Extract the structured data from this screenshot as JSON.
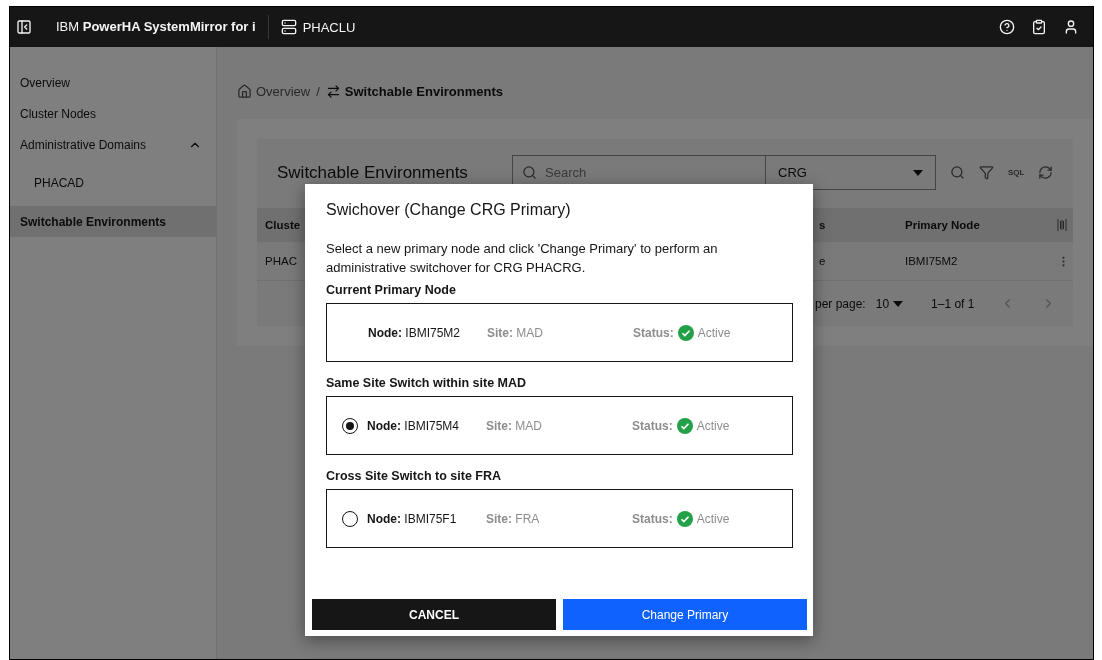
{
  "header": {
    "app_name": "IBM **PowerHA SystemMirror for i**",
    "cluster": "PHACLU"
  },
  "sidebar": {
    "items": [
      {
        "label": "Overview",
        "selected": false
      },
      {
        "label": "Cluster Nodes",
        "selected": false
      },
      {
        "label": "Administrative Domains",
        "selected": false,
        "expanded": true,
        "children": [
          {
            "label": "PHACAD",
            "selected": false
          }
        ]
      },
      {
        "label": "Switchable Environments",
        "selected": true
      }
    ]
  },
  "breadcrumb_separator": "/",
  "breadcrumb": [
    {
      "label": "Overview",
      "kind": "home"
    },
    {
      "label": "Switchable Environments",
      "kind": "switch"
    }
  ],
  "table": {
    "title": "Switchable Environments",
    "search": {
      "placeholder": "Search"
    },
    "type_select": {
      "value": "CRG"
    },
    "sql_label": "SQL",
    "columns": [
      "Cluste",
      "s",
      "Primary Node"
    ],
    "rows": [
      [
        "PHAC",
        "e",
        "IBMI75M2"
      ]
    ],
    "pagination": {
      "per_page_label": "per page:",
      "per_page": "10",
      "range": "1–1 of 1"
    }
  },
  "dialog": {
    "title": "Swichover (Change CRG Primary)",
    "description": "Select a new primary node and click 'Change Primary' to perform an administrative switchover for CRG PHACRG.",
    "sections": [
      {
        "heading": "Current Primary Node",
        "kind": "info",
        "node": "**Node:** IBMI75M2",
        "site": "**Site:** MAD",
        "status_label": "Status:",
        "status": "Active"
      },
      {
        "heading": "Same Site Switch within site MAD",
        "kind": "radio",
        "selected": true,
        "node": "**Node:** IBMI75M4",
        "site": "**Site:** MAD",
        "status_label": "Status:",
        "status": "Active"
      },
      {
        "heading": "Cross Site Switch to site FRA",
        "kind": "radio",
        "selected": false,
        "node": "**Node:** IBMI75F1",
        "site": "**Site:** FRA",
        "status_label": "Status:",
        "status": "Active"
      }
    ],
    "buttons": [
      {
        "label": "CANCEL",
        "kind": "secondary"
      },
      {
        "label": "Change Primary",
        "kind": "primary"
      }
    ]
  }
}
